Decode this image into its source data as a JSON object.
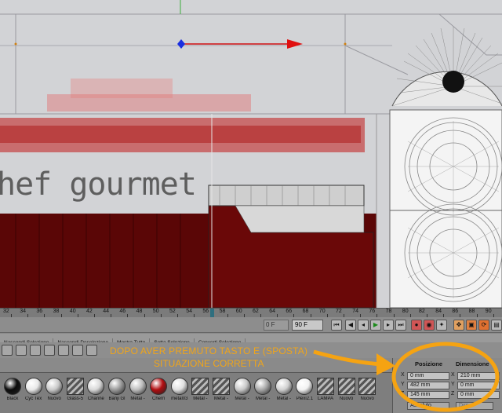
{
  "viewport": {
    "logo_text": "hef gourmet"
  },
  "timeline": {
    "ticks": [
      "32",
      "34",
      "36",
      "38",
      "40",
      "42",
      "44",
      "46",
      "48",
      "50",
      "52",
      "54",
      "56",
      "58",
      "60",
      "62",
      "64",
      "66",
      "68",
      "70",
      "72",
      "74",
      "76",
      "78",
      "80",
      "82",
      "84",
      "86",
      "88",
      "90"
    ],
    "frame_field": "90 F",
    "frame_left_field": "0 F"
  },
  "selection_menu": {
    "items": [
      "Nascondi Selezione",
      "Nascondi Deselezione",
      "Mostra Tutto",
      "Setta Selezione",
      "Converti Selezione"
    ]
  },
  "annotation": {
    "line1": "DOPO AVER PREMUTO TASTO E (SPOSTA)",
    "line2": "SITUAZIONE CORRETTA",
    "color": "#f0a51a"
  },
  "materials": [
    {
      "label": "Black",
      "color": "#0b0b0b"
    },
    {
      "label": "Cyc Tex",
      "color": "#e8e8e8"
    },
    {
      "label": "Nuovo",
      "color": "#c9c9c9"
    },
    {
      "label": "Glass-5",
      "color": "pattern"
    },
    {
      "label": "Channe",
      "color": "#d8d8d8"
    },
    {
      "label": "Banji Gl",
      "color": "#9a9a9a"
    },
    {
      "label": "Metal -",
      "color": "#bdbdbd"
    },
    {
      "label": "Chern",
      "color": "#b10d10"
    },
    {
      "label": "metal03",
      "color": "#e0e0e0"
    },
    {
      "label": "Metal -",
      "color": "pattern"
    },
    {
      "label": "Metal -",
      "color": "pattern"
    },
    {
      "label": "Metal -",
      "color": "#c8c8c8"
    },
    {
      "label": "Metal -",
      "color": "#a8a8a8"
    },
    {
      "label": "Metal -",
      "color": "#d0d0d0"
    },
    {
      "label": "Plexi2.1",
      "color": "#f2f2f2"
    },
    {
      "label": "LAMPA",
      "color": "pattern"
    },
    {
      "label": "Nuovo",
      "color": "pattern"
    },
    {
      "label": "Nuovo",
      "color": "pattern"
    }
  ],
  "coords": {
    "posizione_label": "Posizione",
    "dimensione_label": "Dimensione",
    "rows": [
      {
        "axis": "X",
        "pos": "0 mm",
        "axis2": "X",
        "dim": "210 mm"
      },
      {
        "axis": "Y",
        "pos": "482 mm",
        "axis2": "Y",
        "dim": "0 mm"
      },
      {
        "axis": "Z",
        "pos": "145 mm",
        "axis2": "Z",
        "dim": "0 mm"
      }
    ],
    "mode": "Assoluto",
    "mode2": "Dim."
  }
}
